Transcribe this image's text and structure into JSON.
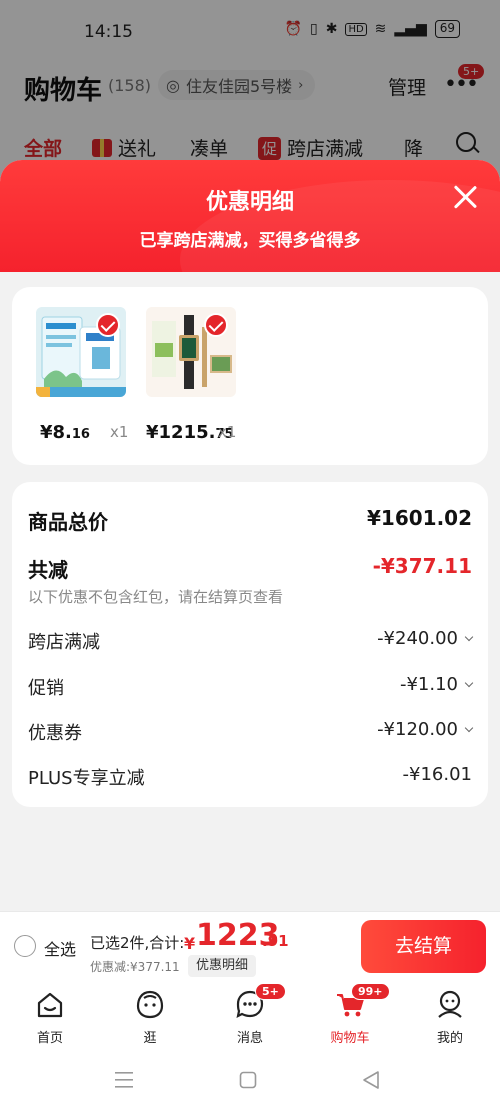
{
  "status_bar": {
    "time": "14:15",
    "battery": "69",
    "hd": "HD"
  },
  "header": {
    "title": "购物车",
    "count": "(158)",
    "address": "住友佳园5号楼",
    "manage": "管理",
    "more_badge": "5+"
  },
  "tabs": {
    "all": "全部",
    "gift": "送礼",
    "bundle": "凑单",
    "promo_tag": "促",
    "cross_store": "跨店满减",
    "price_drop": "降"
  },
  "sheet": {
    "title": "优惠明细",
    "subtitle": "已享跨店满减，买得多省得多"
  },
  "products": [
    {
      "price_int": "¥8.",
      "price_dec": "16",
      "qty": "x1",
      "thumb_text": "海洋薄荷味牙膏100g"
    },
    {
      "price_int": "¥1215.",
      "price_dec": "75",
      "qty": "x1",
      "brand": "LOLA ROSE"
    }
  ],
  "summary": {
    "total_label": "商品总价",
    "total_value": "¥1601.02",
    "reduce_label": "共减",
    "reduce_value": "-¥377.11",
    "reduce_hint": "以下优惠不包含红包，请在结算页查看",
    "items": [
      {
        "label": "跨店满减",
        "value": "-¥240.00"
      },
      {
        "label": "促销",
        "value": "-¥1.10"
      },
      {
        "label": "优惠券",
        "value": "-¥120.00"
      },
      {
        "label": "PLUS专享立减",
        "value": "-¥16.01"
      }
    ]
  },
  "checkout": {
    "select_all": "全选",
    "selected_text": "已选2件,合计:",
    "currency": "¥",
    "total_int": "1223",
    "total_dec": ".91",
    "discount_text": "优惠减:¥377.11",
    "detail_button": "优惠明细",
    "checkout_button": "去结算"
  },
  "nav": {
    "home": "首页",
    "browse": "逛",
    "messages": "消息",
    "messages_badge": "5+",
    "cart": "购物车",
    "cart_badge": "99+",
    "me": "我的"
  },
  "colors": {
    "accent": "#e4262b",
    "header_red": "#f5222d"
  }
}
